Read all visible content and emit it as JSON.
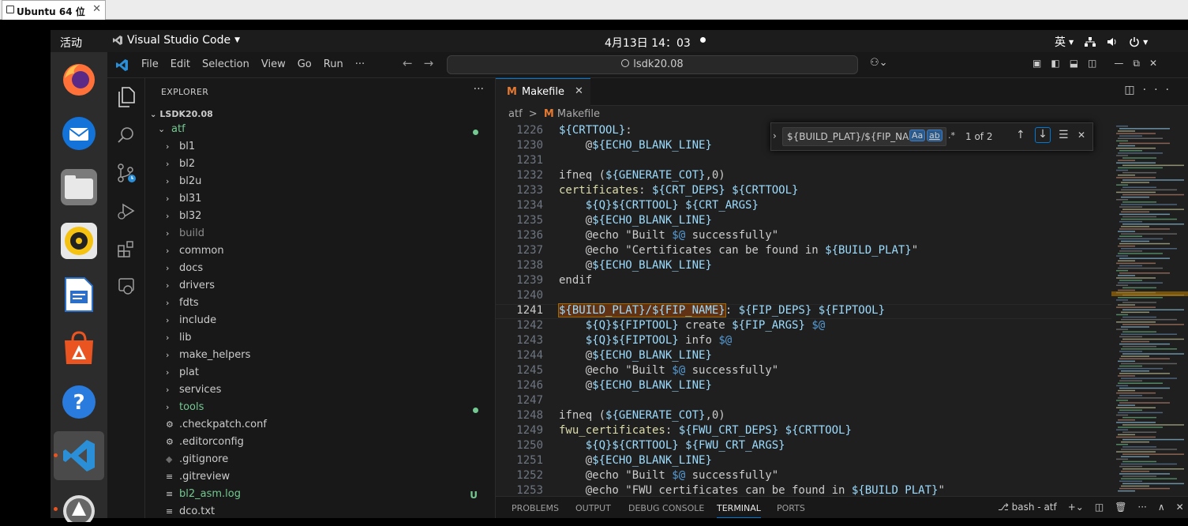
{
  "window": {
    "tab_title": "Ubuntu 64 位",
    "close": "✕"
  },
  "topbar": {
    "activities": "活动",
    "app": "Visual Studio Code",
    "clock": "4月13日  14：03",
    "ime": "英"
  },
  "dock": [
    "firefox",
    "thunderbird",
    "files",
    "rhythmbox",
    "libreoffice-writer",
    "app-center",
    "help",
    "vscode",
    "software-updater"
  ],
  "menu": [
    "File",
    "Edit",
    "Selection",
    "View",
    "Go",
    "Run",
    "···"
  ],
  "search": "lsdk20.08",
  "sidebar": {
    "title": "EXPLORER",
    "more": "···",
    "root": "LSDK20.08",
    "items": [
      {
        "label": "atf",
        "kind": "open",
        "indent": 0,
        "color": "#73c991",
        "git": "dot"
      },
      {
        "label": "bl1",
        "kind": "closed",
        "indent": 1,
        "color": "#cccccc"
      },
      {
        "label": "bl2",
        "kind": "closed",
        "indent": 1,
        "color": "#cccccc"
      },
      {
        "label": "bl2u",
        "kind": "closed",
        "indent": 1,
        "color": "#cccccc"
      },
      {
        "label": "bl31",
        "kind": "closed",
        "indent": 1,
        "color": "#cccccc"
      },
      {
        "label": "bl32",
        "kind": "closed",
        "indent": 1,
        "color": "#cccccc"
      },
      {
        "label": "build",
        "kind": "closed",
        "indent": 1,
        "color": "#8c8c8c"
      },
      {
        "label": "common",
        "kind": "closed",
        "indent": 1,
        "color": "#cccccc"
      },
      {
        "label": "docs",
        "kind": "closed",
        "indent": 1,
        "color": "#cccccc"
      },
      {
        "label": "drivers",
        "kind": "closed",
        "indent": 1,
        "color": "#cccccc"
      },
      {
        "label": "fdts",
        "kind": "closed",
        "indent": 1,
        "color": "#cccccc"
      },
      {
        "label": "include",
        "kind": "closed",
        "indent": 1,
        "color": "#cccccc"
      },
      {
        "label": "lib",
        "kind": "closed",
        "indent": 1,
        "color": "#cccccc"
      },
      {
        "label": "make_helpers",
        "kind": "closed",
        "indent": 1,
        "color": "#cccccc"
      },
      {
        "label": "plat",
        "kind": "closed",
        "indent": 1,
        "color": "#cccccc"
      },
      {
        "label": "services",
        "kind": "closed",
        "indent": 1,
        "color": "#cccccc"
      },
      {
        "label": "tools",
        "kind": "closed",
        "indent": 1,
        "color": "#73c991",
        "git": "dot"
      },
      {
        "label": ".checkpatch.conf",
        "kind": "gear",
        "indent": 1,
        "color": "#cccccc"
      },
      {
        "label": ".editorconfig",
        "kind": "gear",
        "indent": 1,
        "color": "#cccccc"
      },
      {
        "label": ".gitignore",
        "kind": "git",
        "indent": 1,
        "color": "#cccccc"
      },
      {
        "label": ".gitreview",
        "kind": "lines",
        "indent": 1,
        "color": "#cccccc"
      },
      {
        "label": "bl2_asm.log",
        "kind": "lines",
        "indent": 1,
        "color": "#73c991",
        "git": "U"
      },
      {
        "label": "dco.txt",
        "kind": "lines",
        "indent": 1,
        "color": "#cccccc"
      }
    ]
  },
  "tab": {
    "icon": "M",
    "label": "Makefile",
    "close": "✕"
  },
  "breadcrumb": {
    "folder": "atf",
    "file": "Makefile",
    "icon": "M",
    "sep": ">"
  },
  "find": {
    "query": "${BUILD_PLAT}/${FIP_NA",
    "opt_case": "Aa",
    "opt_word": "ab",
    "opt_regex": ".*",
    "count": "1 of 2"
  },
  "code": [
    {
      "n": "1226",
      "t": [
        [
          "v",
          "${CRTTOOL}"
        ],
        [
          "kw",
          ":"
        ]
      ]
    },
    {
      "n": "1230",
      "t": [
        [
          "kw",
          "    @"
        ],
        [
          "v",
          "${ECHO_BLANK_LINE}"
        ]
      ]
    },
    {
      "n": "1231",
      "t": []
    },
    {
      "n": "1232",
      "t": [
        [
          "kw",
          "ifneq ("
        ],
        [
          "v",
          "${GENERATE_COT}"
        ],
        [
          "kw",
          ",0)"
        ]
      ]
    },
    {
      "n": "1233",
      "t": [
        [
          "p",
          "certificates"
        ],
        [
          "kw",
          ": "
        ],
        [
          "v",
          "${CRT_DEPS}"
        ],
        [
          "kw",
          " "
        ],
        [
          "v",
          "${CRTTOOL}"
        ]
      ]
    },
    {
      "n": "1234",
      "t": [
        [
          "kw",
          "    "
        ],
        [
          "v",
          "${Q}${CRTTOOL}"
        ],
        [
          "kw",
          " "
        ],
        [
          "v",
          "${CRT_ARGS}"
        ]
      ]
    },
    {
      "n": "1235",
      "t": [
        [
          "kw",
          "    @"
        ],
        [
          "v",
          "${ECHO_BLANK_LINE}"
        ]
      ]
    },
    {
      "n": "1236",
      "t": [
        [
          "kw",
          "    @echo \"Built "
        ],
        [
          "dl",
          "$@"
        ],
        [
          "kw",
          " successfully\""
        ]
      ]
    },
    {
      "n": "1237",
      "t": [
        [
          "kw",
          "    @echo \"Certificates can be found in "
        ],
        [
          "v",
          "${BUILD_PLAT}"
        ],
        [
          "kw",
          "\""
        ]
      ]
    },
    {
      "n": "1238",
      "t": [
        [
          "kw",
          "    @"
        ],
        [
          "v",
          "${ECHO_BLANK_LINE}"
        ]
      ]
    },
    {
      "n": "1239",
      "t": [
        [
          "kw",
          "endif"
        ]
      ]
    },
    {
      "n": "1240",
      "t": []
    },
    {
      "n": "1241",
      "t": [
        [
          "hl",
          "${BUILD_PLAT}/${FIP_NAME}"
        ],
        [
          "kw",
          ": "
        ],
        [
          "v",
          "${FIP_DEPS}"
        ],
        [
          "kw",
          " "
        ],
        [
          "v",
          "${FIPTOOL}"
        ]
      ],
      "current": true
    },
    {
      "n": "1242",
      "t": [
        [
          "kw",
          "    "
        ],
        [
          "v",
          "${Q}${FIPTOOL}"
        ],
        [
          "kw",
          " create "
        ],
        [
          "v",
          "${FIP_ARGS}"
        ],
        [
          "kw",
          " "
        ],
        [
          "dl",
          "$@"
        ]
      ]
    },
    {
      "n": "1243",
      "t": [
        [
          "kw",
          "    "
        ],
        [
          "v",
          "${Q}${FIPTOOL}"
        ],
        [
          "kw",
          " info "
        ],
        [
          "dl",
          "$@"
        ]
      ]
    },
    {
      "n": "1244",
      "t": [
        [
          "kw",
          "    @"
        ],
        [
          "v",
          "${ECHO_BLANK_LINE}"
        ]
      ]
    },
    {
      "n": "1245",
      "t": [
        [
          "kw",
          "    @echo \"Built "
        ],
        [
          "dl",
          "$@"
        ],
        [
          "kw",
          " successfully\""
        ]
      ]
    },
    {
      "n": "1246",
      "t": [
        [
          "kw",
          "    @"
        ],
        [
          "v",
          "${ECHO_BLANK_LINE}"
        ]
      ]
    },
    {
      "n": "1247",
      "t": []
    },
    {
      "n": "1248",
      "t": [
        [
          "kw",
          "ifneq ("
        ],
        [
          "v",
          "${GENERATE_COT}"
        ],
        [
          "kw",
          ",0)"
        ]
      ]
    },
    {
      "n": "1249",
      "t": [
        [
          "p",
          "fwu_certificates"
        ],
        [
          "kw",
          ": "
        ],
        [
          "v",
          "${FWU_CRT_DEPS}"
        ],
        [
          "kw",
          " "
        ],
        [
          "v",
          "${CRTTOOL}"
        ]
      ]
    },
    {
      "n": "1250",
      "t": [
        [
          "kw",
          "    "
        ],
        [
          "v",
          "${Q}${CRTTOOL}"
        ],
        [
          "kw",
          " "
        ],
        [
          "v",
          "${FWU_CRT_ARGS}"
        ]
      ]
    },
    {
      "n": "1251",
      "t": [
        [
          "kw",
          "    @"
        ],
        [
          "v",
          "${ECHO_BLANK_LINE}"
        ]
      ]
    },
    {
      "n": "1252",
      "t": [
        [
          "kw",
          "    @echo \"Built "
        ],
        [
          "dl",
          "$@"
        ],
        [
          "kw",
          " successfully\""
        ]
      ]
    },
    {
      "n": "1253",
      "t": [
        [
          "kw",
          "    @echo \"FWU certificates can be found in "
        ],
        [
          "v",
          "${BUILD_PLAT}"
        ],
        [
          "kw",
          "\""
        ]
      ]
    }
  ],
  "panel": {
    "tabs": [
      "PROBLEMS",
      "OUTPUT",
      "DEBUG CONSOLE",
      "TERMINAL",
      "PORTS"
    ],
    "active": "TERMINAL",
    "terminal": "bash - atf"
  }
}
